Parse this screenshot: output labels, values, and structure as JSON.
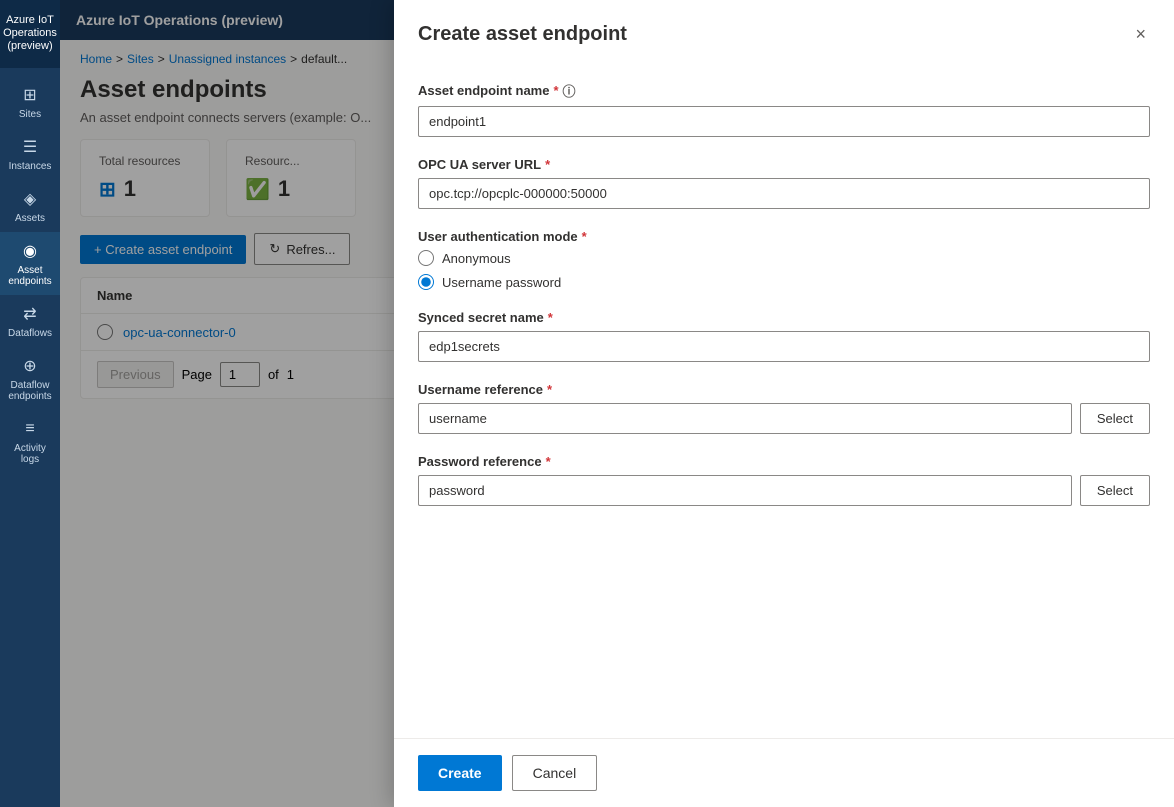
{
  "app": {
    "title": "Azure IoT Operations (preview)"
  },
  "sidebar": {
    "items": [
      {
        "id": "sites",
        "label": "Sites",
        "icon": "⊞"
      },
      {
        "id": "instances",
        "label": "Instances",
        "icon": "⊟"
      },
      {
        "id": "assets",
        "label": "Assets",
        "icon": "◈"
      },
      {
        "id": "asset-endpoints",
        "label": "Asset endpoints",
        "icon": "◉",
        "active": true
      },
      {
        "id": "dataflows",
        "label": "Dataflows",
        "icon": "⇄"
      },
      {
        "id": "dataflow-endpoints",
        "label": "Dataflow endpoints",
        "icon": "⊕"
      },
      {
        "id": "activity-logs",
        "label": "Activity logs",
        "icon": "≡"
      }
    ]
  },
  "breadcrumb": {
    "parts": [
      "Home",
      "Sites",
      "Unassigned instances",
      "default..."
    ]
  },
  "page": {
    "title": "Asset endpoints",
    "description": "An asset endpoint connects servers (example: O..."
  },
  "stats": {
    "total_resources": {
      "label": "Total resources",
      "value": "1",
      "icon": "⊞"
    },
    "resource_ok": {
      "label": "Resourc...",
      "value": "1",
      "icon": "✅"
    }
  },
  "toolbar": {
    "create_label": "+ Create asset endpoint",
    "refresh_label": "Refres..."
  },
  "table": {
    "columns": [
      "Name"
    ],
    "rows": [
      {
        "name": "opc-ua-connector-0"
      }
    ]
  },
  "pagination": {
    "previous_label": "Previous",
    "page_label": "Page",
    "current_page": "1",
    "of_label": "of",
    "total_pages": "1"
  },
  "dialog": {
    "title": "Create asset endpoint",
    "close_label": "×",
    "fields": {
      "endpoint_name": {
        "label": "Asset endpoint name",
        "required": true,
        "info": true,
        "value": "endpoint1"
      },
      "opc_url": {
        "label": "OPC UA server URL",
        "required": true,
        "value": "opc.tcp://opcplc-000000:50000"
      },
      "auth_mode": {
        "label": "User authentication mode",
        "required": true,
        "options": [
          {
            "id": "anonymous",
            "label": "Anonymous",
            "selected": false
          },
          {
            "id": "username-password",
            "label": "Username password",
            "selected": true
          }
        ]
      },
      "synced_secret": {
        "label": "Synced secret name",
        "required": true,
        "value": "edp1secrets"
      },
      "username_ref": {
        "label": "Username reference",
        "required": true,
        "value": "username",
        "select_label": "Select"
      },
      "password_ref": {
        "label": "Password reference",
        "required": true,
        "value": "password",
        "select_label": "Select"
      }
    },
    "footer": {
      "create_label": "Create",
      "cancel_label": "Cancel"
    }
  }
}
